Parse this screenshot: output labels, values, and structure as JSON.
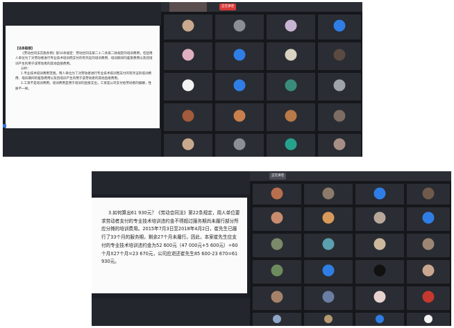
{
  "shot1": {
    "slide_title": "【法条链接】",
    "slide_paragraphs": [
      "《劳动合同法实施条例》第16条规定：劳动合同法第二十二条第二款规定的培训费用，包括用人单位为了对劳动者进行专业技术培训而支付的有凭证的培训费用、培训期间的差旅费用以及因培训产生的用于该劳动者的其他直接费用。",
      "分析：",
      "1.专业技术培训费用范围。用人单位为了对劳动者进行专业技术培训而支付的有凭证的培训费用、培训期间的差旅费用以及因培训产生的用于该劳动者的其他直接费用。",
      "2.工资不是培训费用。培训费用是用于培训的直接支出，工资是公司支付给劳动者的报酬，性质不一样。"
    ],
    "speaker_badge": "正在讲话"
  },
  "shot2": {
    "slide_text": "3.如何算出61 930元？《劳动合同法》第22条规定，用人单位要求劳动者支付的专业技术培训违约金不得超过服务期尚未履行部分所应分摊的培训费用。2015年7月3日至2018年4月2日，崔先生已履行了33个月的服务期，剩余27个月未履行。因此，本案崔先生应支付的专业技术培训违约金为52 600元（47 000元+5 600元）÷60个月X27个月=23 670元，公司应退还崔先生85 600-23 670=61 930元。",
    "speaker_badge": "正在讲话"
  },
  "tile_colors": {
    "blue": "#2f7ee6",
    "teal": "#25a38f",
    "white": "#f3f3f3"
  }
}
